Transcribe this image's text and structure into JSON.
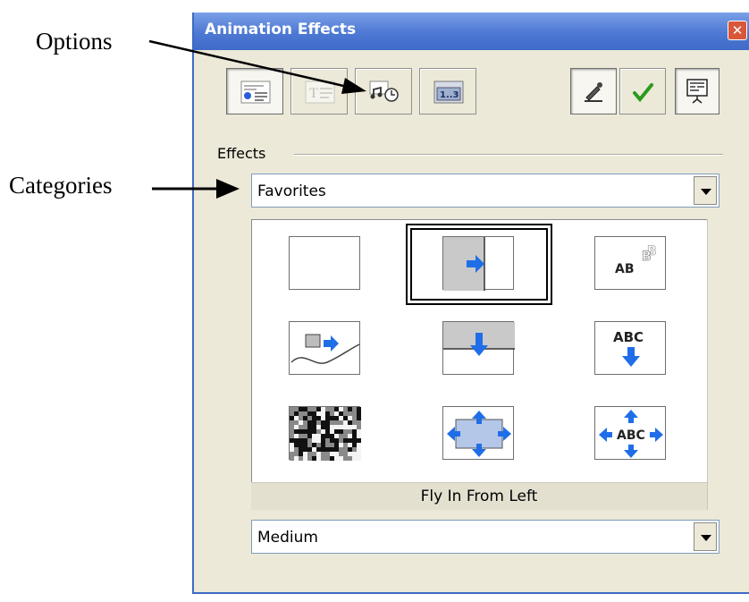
{
  "annotations": {
    "options_label": "Options",
    "categories_label": "Categories"
  },
  "window": {
    "title": "Animation Effects",
    "close_icon": "close-icon"
  },
  "toolbar": {
    "left_buttons": [
      {
        "icon": "effects-list-icon",
        "pressed": true
      },
      {
        "icon": "text-animation-icon",
        "pressed": false
      },
      {
        "icon": "sound-timing-options-icon",
        "pressed": false
      },
      {
        "icon": "animation-order-icon",
        "pressed": false
      }
    ],
    "right_buttons": [
      {
        "icon": "edit-pen-icon",
        "pressed": true
      },
      {
        "icon": "apply-checkmark-icon",
        "pressed": false
      },
      {
        "icon": "preview-screen-icon",
        "pressed": false
      }
    ]
  },
  "effects": {
    "group_label": "Effects",
    "category": "Favorites",
    "speed": "Medium",
    "selected_caption": "Fly In From Left",
    "tiles": [
      {
        "icon": "no-effect-icon"
      },
      {
        "icon": "fly-in-from-left-icon",
        "selected": true
      },
      {
        "icon": "text-fade-icon",
        "text": "AB"
      },
      {
        "icon": "path-motion-icon"
      },
      {
        "icon": "fly-in-from-top-icon"
      },
      {
        "icon": "text-drop-in-icon",
        "text": "ABC"
      },
      {
        "icon": "dissolve-icon"
      },
      {
        "icon": "expand-icon"
      },
      {
        "icon": "text-expand-icon",
        "text": "ABC"
      }
    ]
  },
  "colors": {
    "title_bar": "#4d78d4",
    "window_bg": "#ece9d8",
    "accent_arrow": "#1f6ee8"
  }
}
